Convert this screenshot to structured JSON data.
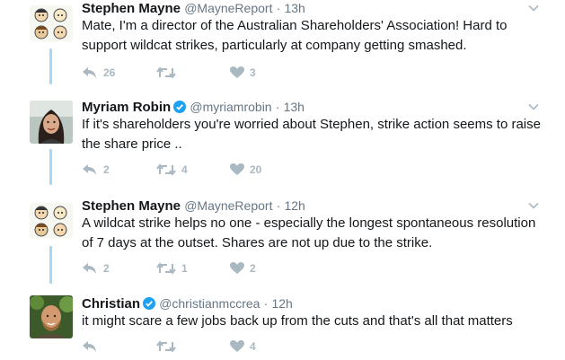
{
  "tweets": [
    {
      "name": "Stephen Mayne",
      "handle": "@MayneReport",
      "dot": "·",
      "time": "13h",
      "verified": false,
      "text": "Mate, I'm a director of the Australian Shareholders' Association! Hard to support wildcat strikes, particularly at company getting smashed.",
      "replies": "26",
      "retweets": "",
      "likes": "3"
    },
    {
      "name": "Myriam Robin",
      "handle": "@myriamrobin",
      "dot": "·",
      "time": "13h",
      "verified": true,
      "text": "If it's shareholders you're worried about Stephen, strike action seems to raise the share price ..",
      "replies": "2",
      "retweets": "4",
      "likes": "20"
    },
    {
      "name": "Stephen Mayne",
      "handle": "@MayneReport",
      "dot": "·",
      "time": "12h",
      "verified": false,
      "text": "A wildcat strike helps no one - especially the longest spontaneous resolution of 7 days at the outset. Shares are not up due to the strike.",
      "replies": "2",
      "retweets": "1",
      "likes": "2"
    },
    {
      "name": "Christian",
      "handle": "@christianmccrea",
      "dot": "·",
      "time": "12h",
      "verified": true,
      "text": "it might scare a few jobs back up from the cuts and that's all that matters",
      "replies": "",
      "retweets": "",
      "likes": "4"
    }
  ],
  "icons": {
    "reply": "reply-icon",
    "retweet": "retweet-icon",
    "like": "heart-icon",
    "more": "chevron-down-icon",
    "verified": "verified-badge-icon"
  },
  "colors": {
    "thread_line": "#a6d8f5",
    "action_gray": "#aab8c2",
    "verified_blue": "#1da1f2",
    "meta_gray": "#657786"
  }
}
